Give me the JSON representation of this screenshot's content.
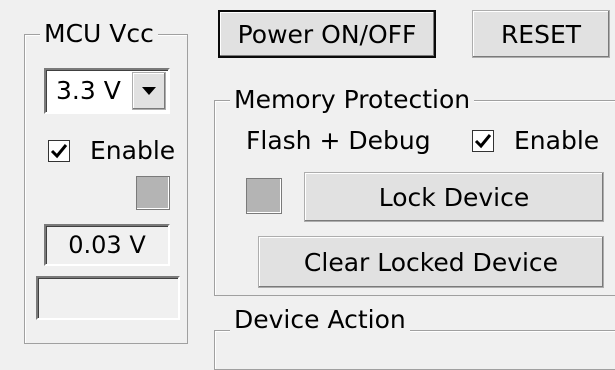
{
  "mcu_vcc": {
    "title": "MCU Vcc",
    "voltage_select": "3.3 V",
    "enable_label": "Enable",
    "enable_checked": true,
    "measured_voltage": "0.03 V",
    "status_text": ""
  },
  "toolbar": {
    "power_label": "Power ON/OFF",
    "reset_label": "RESET"
  },
  "memory_protection": {
    "title": "Memory Protection",
    "flash_label": "Flash + Debug",
    "enable_label": "Enable",
    "enable_checked": true,
    "lock_label": "Lock Device",
    "clear_label": "Clear Locked Device"
  },
  "device_action": {
    "title": "Device Action"
  },
  "icons": {
    "checkmark": "checkmark-icon",
    "dropdown": "chevron-down-icon"
  },
  "colors": {
    "window_bg": "#f0f0f0",
    "indicator_gray": "#b4b4b4",
    "button_face": "#e1e1e1"
  }
}
